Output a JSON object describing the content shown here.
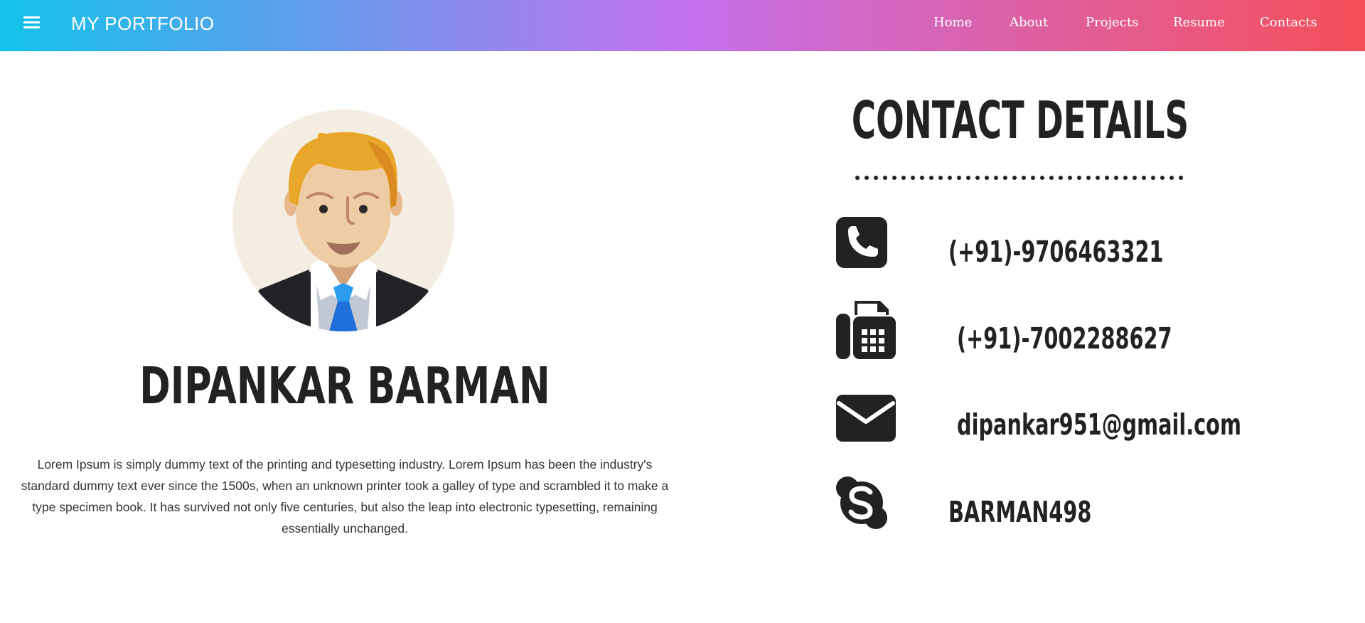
{
  "navbar": {
    "brand": "MY PORTFOLIO",
    "menu_icon": "hamburger-menu-icon",
    "links": [
      "Home",
      "About",
      "Projects",
      "Resume",
      "Contacts"
    ],
    "gradient_colors": [
      "#12c2e9",
      "#c471ed",
      "#f64f59"
    ]
  },
  "profile": {
    "avatar": "businessman-avatar-illustration",
    "name": "DIPANKAR BARMAN",
    "bio": "Lorem Ipsum is simply dummy text of the printing and typesetting industry. Lorem Ipsum has been the industry's standard dummy text ever since the 1500s, when an unknown printer took a galley of type and scrambled it to make a type specimen book. It has survived not only five centuries, but also the leap into electronic typesetting, remaining essentially unchanged."
  },
  "contact": {
    "title": "CONTACT DETAILS",
    "items": [
      {
        "icon": "phone-icon",
        "text": "(+91)-9706463321"
      },
      {
        "icon": "fax-icon",
        "text": "(+91)-7002288627"
      },
      {
        "icon": "envelope-icon",
        "text": "dipankar951@gmail.com"
      },
      {
        "icon": "skype-icon",
        "text": "BARMAN498"
      }
    ]
  }
}
